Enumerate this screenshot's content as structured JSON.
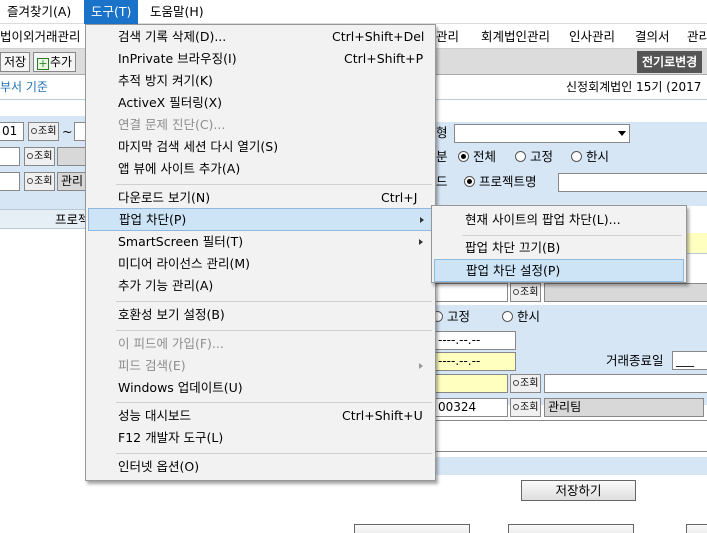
{
  "menubar": {
    "favorites": "즐겨찾기(A)",
    "tools": "도구(T)",
    "help": "도움말(H)"
  },
  "nav": {
    "left_item": "법이외거래관리",
    "items": [
      "관리",
      "회계법인관리",
      "인사관리",
      "결의서",
      "관리"
    ]
  },
  "toolbar": {
    "save": "저장",
    "add": "추가",
    "switch": "전기로변경"
  },
  "info": {
    "left": "부서 기준",
    "right": "신정회계법인 15기 (2017"
  },
  "left_panel": {
    "date_from": "01",
    "tilde": "~",
    "search": "조회",
    "manage": "관리",
    "col_header": "프로젝"
  },
  "right_panel": {
    "type_label": "형",
    "class_label": "분",
    "radio_all": "전체",
    "radio_fixed": "고정",
    "radio_onetime": "한시",
    "code_label": "드",
    "radio_project": "프로젝트명",
    "search": "조회",
    "radio_fixed2": "고정",
    "radio_onetime2": "한시",
    "date1": "----.--.--",
    "date2": "----.--.--",
    "end_date_label": "거래종료일",
    "end_date_value": "___",
    "code_value": "00324",
    "team": "관리팀",
    "save_btn": "저장하기"
  },
  "tools_menu": {
    "items": [
      {
        "label": "검색 기록 삭제(D)...",
        "shortcut": "Ctrl+Shift+Del"
      },
      {
        "label": "InPrivate 브라우징(I)",
        "shortcut": "Ctrl+Shift+P"
      },
      {
        "label": "추적 방지 켜기(K)",
        "shortcut": ""
      },
      {
        "label": "ActiveX 필터링(X)",
        "shortcut": ""
      },
      {
        "label": "연결 문제 진단(C)...",
        "shortcut": ""
      },
      {
        "label": "마지막 검색 세션 다시 열기(S)",
        "shortcut": ""
      },
      {
        "label": "앱 뷰에 사이트 추가(A)",
        "shortcut": ""
      },
      {
        "label": "다운로드 보기(N)",
        "shortcut": "Ctrl+J"
      },
      {
        "label": "팝업 차단(P)",
        "shortcut": ""
      },
      {
        "label": "SmartScreen 필터(T)",
        "shortcut": ""
      },
      {
        "label": "미디어 라이선스 관리(M)",
        "shortcut": ""
      },
      {
        "label": "추가 기능 관리(A)",
        "shortcut": ""
      },
      {
        "label": "호환성 보기 설정(B)",
        "shortcut": ""
      },
      {
        "label": "이 피드에 가입(F)...",
        "shortcut": ""
      },
      {
        "label": "피드 검색(E)",
        "shortcut": ""
      },
      {
        "label": "Windows 업데이트(U)",
        "shortcut": ""
      },
      {
        "label": "성능 대시보드",
        "shortcut": "Ctrl+Shift+U"
      },
      {
        "label": "F12 개발자 도구(L)",
        "shortcut": ""
      },
      {
        "label": "인터넷 옵션(O)",
        "shortcut": ""
      }
    ]
  },
  "popup_submenu": {
    "items": [
      {
        "label": "현재 사이트의 팝업 차단(L)..."
      },
      {
        "label": "팝업 차단 끄기(B)"
      },
      {
        "label": "팝업 차단 설정(P)"
      }
    ]
  },
  "colors": {
    "menu_active": "#1a72c9",
    "highlight": "#cde4f7",
    "input_yellow": "#ffffc0",
    "row_blue": "#d6e6f5"
  }
}
